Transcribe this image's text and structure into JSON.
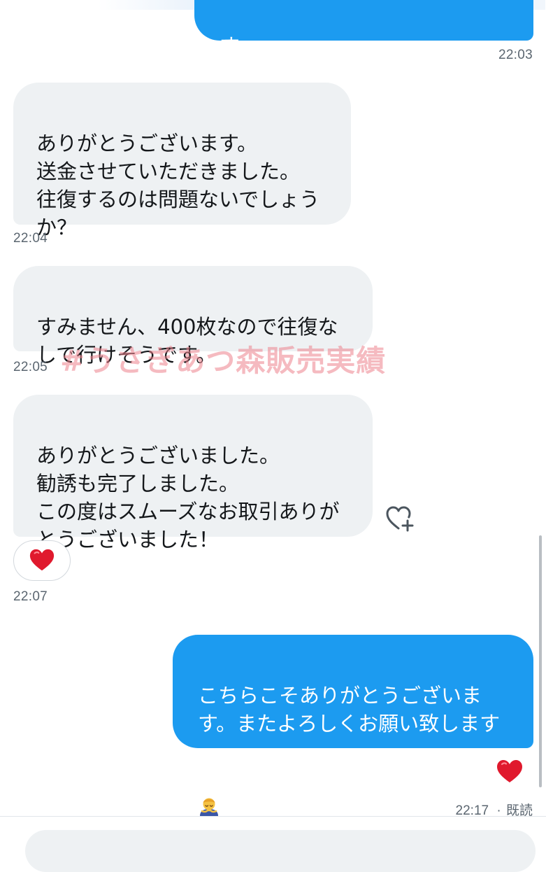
{
  "conversation": {
    "messages": [
      {
        "id": "m0",
        "direction": "outgoing",
        "text": "す。",
        "time": "22:03"
      },
      {
        "id": "m1",
        "direction": "incoming",
        "text": "ありがとうございます。\n送金させていただきました。\n往復するのは問題ないでしょう\nか？",
        "time": "22:04"
      },
      {
        "id": "m2",
        "direction": "incoming",
        "text": "すみません、400枚なので往復な\nしで行けそうです。",
        "time": "22:05"
      },
      {
        "id": "m3",
        "direction": "incoming",
        "text": "ありがとうございました。\n勧誘も完了しました。\nこの度はスムーズなお取引ありが\nとうございました！",
        "time": "22:07",
        "reaction": "red-heart"
      },
      {
        "id": "m4",
        "direction": "outgoing",
        "text": "こちらこそありがとうございま\nす。またよろしくお願い致します",
        "emoji": "person-bowing",
        "time": "22:17",
        "read_label": "既読",
        "reaction": "red-heart"
      }
    ],
    "separator": "·"
  },
  "watermark": "#うさぎあつ森販売実績",
  "colors": {
    "outgoing_bubble": "#1c9bf0",
    "incoming_bubble": "#eef1f3",
    "timestamp": "#5b6670",
    "watermark": "#ec828c",
    "heart": "#e0192d"
  },
  "icons": {
    "add_reaction": "heart-plus-icon",
    "reaction": "red-heart-icon"
  }
}
